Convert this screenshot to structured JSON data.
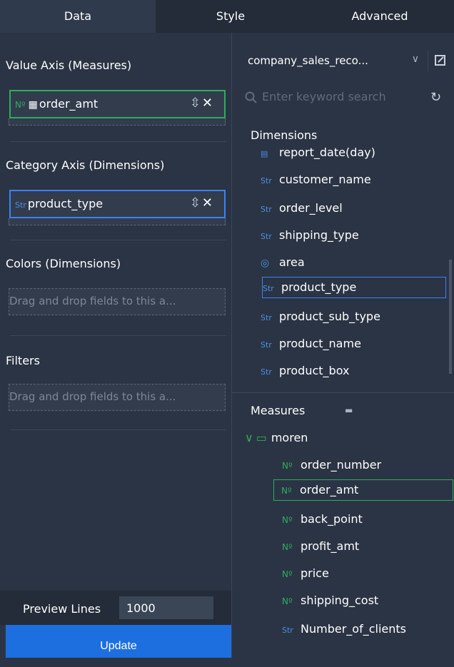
{
  "tabs": [
    "Data",
    "Style",
    "Advanced"
  ],
  "left": {
    "value_axis_title": "Value Axis (Measures)",
    "value_chip": {
      "type": "Nº",
      "label": "order_amt"
    },
    "category_axis_title": "Category Axis (Dimensions)",
    "category_chip": {
      "type": "Str",
      "label": "product_type"
    },
    "colors_title": "Colors (Dimensions)",
    "colors_placeholder": "Drag and drop fields to this a...",
    "filters_title": "Filters",
    "filters_placeholder": "Drag and drop fields to this a...",
    "preview_label": "Preview Lines",
    "preview_value": "1000",
    "update_label": "Update"
  },
  "right": {
    "dataset": "company_sales_reco...",
    "search_placeholder": "Enter keyword search",
    "dimensions_title": "Dimensions",
    "dimensions": [
      {
        "type": "date",
        "name": "report_date(day)"
      },
      {
        "type": "Str",
        "name": "customer_name"
      },
      {
        "type": "Str",
        "name": "order_level"
      },
      {
        "type": "Str",
        "name": "shipping_type"
      },
      {
        "type": "geo",
        "name": "area"
      },
      {
        "type": "Str",
        "name": "product_type"
      },
      {
        "type": "Str",
        "name": "product_sub_type"
      },
      {
        "type": "Str",
        "name": "product_name"
      },
      {
        "type": "Str",
        "name": "product_box"
      }
    ],
    "measures_title": "Measures",
    "folder": "moren",
    "measures": [
      {
        "type": "Nº",
        "name": "order_number"
      },
      {
        "type": "Nº",
        "name": "order_amt"
      },
      {
        "type": "Nº",
        "name": "back_point"
      },
      {
        "type": "Nº",
        "name": "profit_amt"
      },
      {
        "type": "Nº",
        "name": "price"
      },
      {
        "type": "Nº",
        "name": "shipping_cost"
      },
      {
        "type": "Str",
        "name": "Number_of_clients"
      }
    ]
  },
  "colors": {
    "accent": "#1d6fe0",
    "measure": "#2eac5d",
    "dimension": "#4a90e2",
    "panel": "#2b3444"
  }
}
